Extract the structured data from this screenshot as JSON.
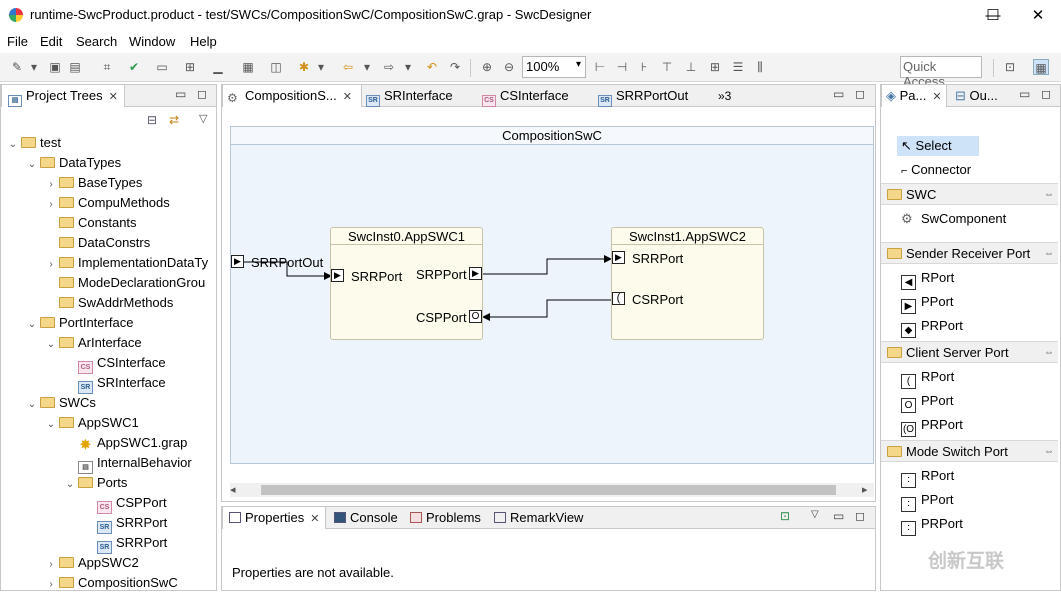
{
  "window": {
    "title": "runtime-SwcProduct.product - test/SWCs/CompositionSwC/CompositionSwC.grap - SwcDesigner",
    "minimize": "—",
    "maximize": "☐",
    "close": "✕"
  },
  "menu": [
    "File",
    "Edit",
    "Search",
    "Window",
    "Help"
  ],
  "toolbar": {
    "zoom": "100%",
    "quick_access_placeholder": "Quick Access"
  },
  "project_trees": {
    "tab_label": "Project Trees",
    "nodes": [
      {
        "label": "test",
        "kind": "folder",
        "expanded": true
      },
      {
        "label": "DataTypes",
        "kind": "folder",
        "expanded": true
      },
      {
        "label": "BaseTypes",
        "kind": "folder",
        "expanded": false
      },
      {
        "label": "CompuMethods",
        "kind": "folder",
        "expanded": false
      },
      {
        "label": "Constants",
        "kind": "folder",
        "expanded": null
      },
      {
        "label": "DataConstrs",
        "kind": "folder",
        "expanded": null
      },
      {
        "label": "ImplementationDataTy",
        "kind": "folder",
        "expanded": false
      },
      {
        "label": "ModeDeclarationGrou",
        "kind": "folder",
        "expanded": null
      },
      {
        "label": "SwAddrMethods",
        "kind": "folder",
        "expanded": null
      },
      {
        "label": "PortInterface",
        "kind": "folder",
        "expanded": true
      },
      {
        "label": "ArInterface",
        "kind": "folder",
        "expanded": true
      },
      {
        "label": "CSInterface",
        "kind": "cs",
        "expanded": null
      },
      {
        "label": "SRInterface",
        "kind": "sr",
        "expanded": null
      },
      {
        "label": "SWCs",
        "kind": "folder",
        "expanded": true
      },
      {
        "label": "AppSWC1",
        "kind": "folder",
        "expanded": true
      },
      {
        "label": "AppSWC1.grap",
        "kind": "grap",
        "expanded": null
      },
      {
        "label": "InternalBehavior",
        "kind": "ib",
        "expanded": null
      },
      {
        "label": "Ports",
        "kind": "folder",
        "expanded": true
      },
      {
        "label": "CSPPort",
        "kind": "cs",
        "expanded": null
      },
      {
        "label": "SRRPort",
        "kind": "sr",
        "expanded": null
      },
      {
        "label": "SRRPort",
        "kind": "sr",
        "expanded": null
      },
      {
        "label": "AppSWC2",
        "kind": "folder",
        "expanded": false
      },
      {
        "label": "CompositionSwC",
        "kind": "folder",
        "expanded": false
      }
    ]
  },
  "editor": {
    "tabs": [
      {
        "label": "CompositionS...",
        "icon": "composition",
        "active": true
      },
      {
        "label": "SRInterface",
        "icon": "SR",
        "active": false
      },
      {
        "label": "CSInterface",
        "icon": "CS",
        "active": false
      },
      {
        "label": "SRRPortOut",
        "icon": "SR",
        "active": false
      }
    ],
    "overflow": "»3",
    "composition_title": "CompositionSwC",
    "outer_port": "SRRPortOut",
    "swc1": {
      "title": "SwcInst0.AppSWC1",
      "ports": [
        "SRRPort",
        "SRPPort",
        "CSPPort"
      ]
    },
    "swc2": {
      "title": "SwcInst1.AppSWC2",
      "ports": [
        "SRRPort",
        "CSRPort"
      ]
    }
  },
  "bottom": {
    "tabs": [
      "Properties",
      "Console",
      "Problems",
      "RemarkView"
    ],
    "message": "Properties are not available."
  },
  "palette": {
    "tab_label": "Pa...",
    "outline_label": "Ou...",
    "tools": [
      "Select",
      "Connector"
    ],
    "groups": [
      {
        "name": "SWC",
        "items": [
          "SwComponent"
        ]
      },
      {
        "name": "Sender Receiver Port",
        "items": [
          "RPort",
          "PPort",
          "PRPort"
        ]
      },
      {
        "name": "Client Server Port",
        "items": [
          "RPort",
          "PPort",
          "PRPort"
        ]
      },
      {
        "name": "Mode Switch Port",
        "items": [
          "RPort",
          "PPort",
          "PRPort"
        ]
      }
    ]
  },
  "watermark": "创新互联",
  "colors": {
    "canvas_bg": "#eef4fb",
    "swc_bg": "#fdfbeb",
    "folder": "#f5d78a",
    "selected": "#cfe3f8"
  }
}
